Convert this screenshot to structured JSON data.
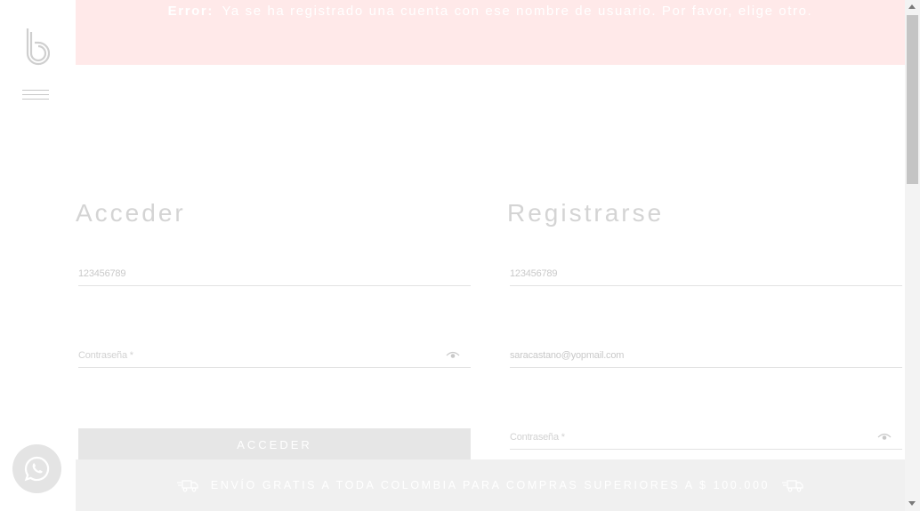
{
  "error": {
    "label": "Error:",
    "message": "Ya se ha registrado una cuenta con ese nombre de usuario. Por favor, elige otro."
  },
  "login": {
    "title": "Acceder",
    "username_value": "123456789",
    "password_placeholder": "Contraseña *",
    "button_label": "ACCEDER"
  },
  "register": {
    "title": "Registrarse",
    "username_value": "123456789",
    "email_value": "saracastano@yopmail.com",
    "password_placeholder": "Contraseña *"
  },
  "shipping": {
    "text": "ENVÍO GRATIS A TODA COLOMBIA PARA COMPRAS SUPERIORES A $ 100.000"
  },
  "icons": {
    "logo": "logo-b-icon",
    "menu": "hamburger-menu-icon",
    "eye": "eye-icon",
    "truck": "delivery-truck-icon",
    "whatsapp": "whatsapp-icon"
  },
  "colors": {
    "error_background": "#ffe9e9",
    "button_background": "#e6e6e6",
    "shipping_background": "#f0f0f0"
  }
}
